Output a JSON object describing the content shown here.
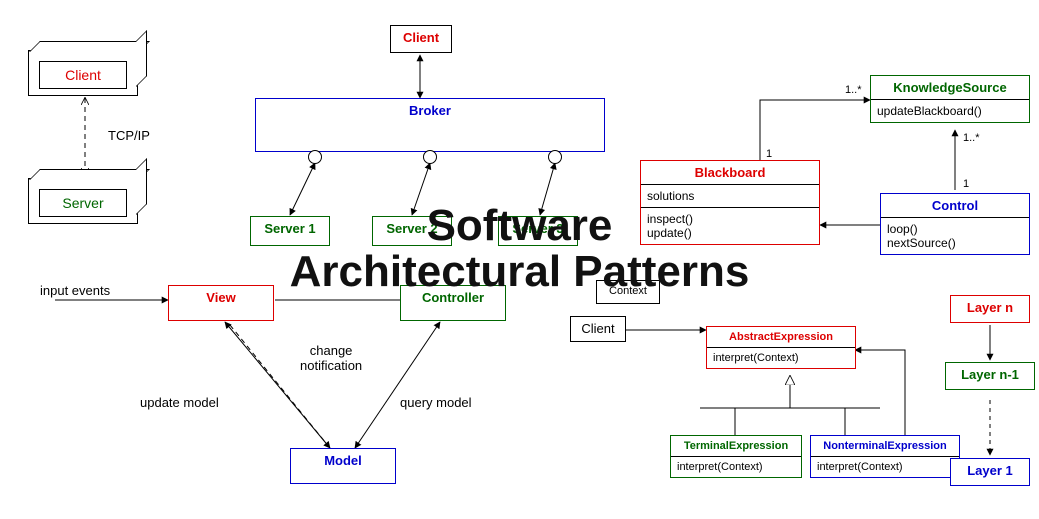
{
  "title_line1": "Software",
  "title_line2": "Architectural Patterns",
  "clientServer": {
    "client": "Client",
    "server": "Server",
    "protocol": "TCP/IP"
  },
  "broker": {
    "client": "Client",
    "broker": "Broker",
    "server1": "Server 1",
    "server2": "Server 2",
    "server3": "Server 3"
  },
  "mvc": {
    "view": "View",
    "controller": "Controller",
    "model": "Model",
    "input_events": "input events",
    "update_model": "update model",
    "query_model": "query model",
    "change_notification": "change\nnotification"
  },
  "blackboard": {
    "blackboard": "Blackboard",
    "solutions": "solutions",
    "inspect": "inspect()",
    "update": "update()",
    "knowledgeSource": "KnowledgeSource",
    "updateBlackboard": "updateBlackboard()",
    "control": "Control",
    "loop": "loop()",
    "nextSource": "nextSource()",
    "mult_one": "1",
    "mult_many": "1..*"
  },
  "interpreter": {
    "client": "Client",
    "context": "Context",
    "abstract": "AbstractExpression",
    "abstract_method": "interpret(Context)",
    "terminal": "TerminalExpression",
    "terminal_method": "interpret(Context)",
    "nonterminal": "NonterminalExpression",
    "nonterminal_method": "interpret(Context)"
  },
  "layers": {
    "top": "Layer n",
    "mid": "Layer n-1",
    "bottom": "Layer 1"
  }
}
